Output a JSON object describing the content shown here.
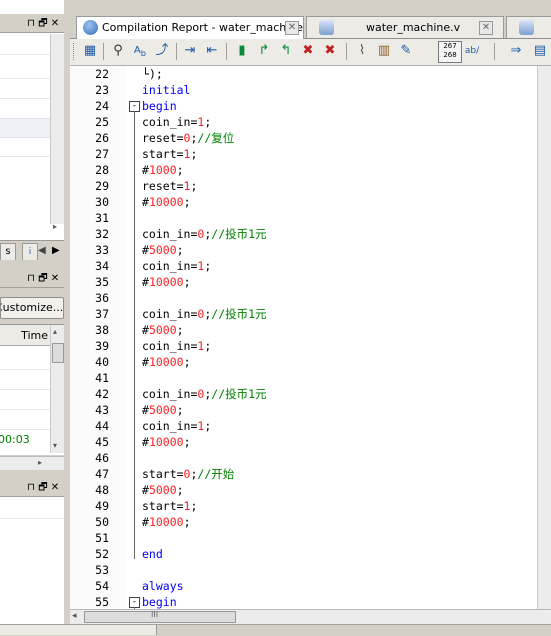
{
  "left_panel": {
    "panel1_buttons": [
      "⊓",
      "🗗",
      "✕"
    ],
    "panel2_buttons": [
      "⊓",
      "🗗",
      "✕"
    ],
    "panel3_buttons": [
      "⊓",
      "🗗",
      "✕"
    ],
    "customize_label": "Customize...",
    "time_header": "Time",
    "time_value": "00:03"
  },
  "tabs": [
    {
      "label": "Compilation Report - water_machine"
    },
    {
      "label": "water_machine.v"
    }
  ],
  "toolbar": {
    "badge_top": "267",
    "badge_bottom": "268",
    "ab_label": "ab/"
  },
  "editor": {
    "lines": [
      {
        "n": "22",
        "code": [
          [
            "",
            "└"
          ],
          [
            "",
            ");"
          ]
        ]
      },
      {
        "n": "23",
        "code": [
          [
            "kw",
            "initial"
          ]
        ]
      },
      {
        "n": "24",
        "code": [
          [
            "kw",
            "begin"
          ]
        ]
      },
      {
        "n": "25",
        "code": [
          [
            "",
            "coin_in="
          ],
          [
            "num",
            "1"
          ],
          [
            "",
            ";"
          ]
        ]
      },
      {
        "n": "26",
        "code": [
          [
            "",
            "reset="
          ],
          [
            "num",
            "0"
          ],
          [
            "",
            ";"
          ],
          [
            "cm",
            "//复位"
          ]
        ]
      },
      {
        "n": "27",
        "code": [
          [
            "",
            "start="
          ],
          [
            "num",
            "1"
          ],
          [
            "",
            ";"
          ]
        ]
      },
      {
        "n": "28",
        "code": [
          [
            "",
            "#"
          ],
          [
            "num",
            "1000"
          ],
          [
            "",
            ";"
          ]
        ]
      },
      {
        "n": "29",
        "code": [
          [
            "",
            "reset="
          ],
          [
            "num",
            "1"
          ],
          [
            "",
            ";"
          ]
        ]
      },
      {
        "n": "30",
        "code": [
          [
            "",
            "#"
          ],
          [
            "num",
            "10000"
          ],
          [
            "",
            ";"
          ]
        ]
      },
      {
        "n": "31",
        "code": []
      },
      {
        "n": "32",
        "code": [
          [
            "",
            "coin_in="
          ],
          [
            "num",
            "0"
          ],
          [
            "",
            ";"
          ],
          [
            "cm",
            "//投币1元"
          ]
        ]
      },
      {
        "n": "33",
        "code": [
          [
            "",
            "#"
          ],
          [
            "num",
            "5000"
          ],
          [
            "",
            ";"
          ]
        ]
      },
      {
        "n": "34",
        "code": [
          [
            "",
            "coin_in="
          ],
          [
            "num",
            "1"
          ],
          [
            "",
            ";"
          ]
        ]
      },
      {
        "n": "35",
        "code": [
          [
            "",
            "#"
          ],
          [
            "num",
            "10000"
          ],
          [
            "",
            ";"
          ]
        ]
      },
      {
        "n": "36",
        "code": []
      },
      {
        "n": "37",
        "code": [
          [
            "",
            "coin_in="
          ],
          [
            "num",
            "0"
          ],
          [
            "",
            ";"
          ],
          [
            "cm",
            "//投币1元"
          ]
        ]
      },
      {
        "n": "38",
        "code": [
          [
            "",
            "#"
          ],
          [
            "num",
            "5000"
          ],
          [
            "",
            ";"
          ]
        ]
      },
      {
        "n": "39",
        "code": [
          [
            "",
            "coin_in="
          ],
          [
            "num",
            "1"
          ],
          [
            "",
            ";"
          ]
        ]
      },
      {
        "n": "40",
        "code": [
          [
            "",
            "#"
          ],
          [
            "num",
            "10000"
          ],
          [
            "",
            ";"
          ]
        ]
      },
      {
        "n": "41",
        "code": []
      },
      {
        "n": "42",
        "code": [
          [
            "",
            "coin_in="
          ],
          [
            "num",
            "0"
          ],
          [
            "",
            ";"
          ],
          [
            "cm",
            "//投币1元"
          ]
        ]
      },
      {
        "n": "43",
        "code": [
          [
            "",
            "#"
          ],
          [
            "num",
            "5000"
          ],
          [
            "",
            ";"
          ]
        ]
      },
      {
        "n": "44",
        "code": [
          [
            "",
            "coin_in="
          ],
          [
            "num",
            "1"
          ],
          [
            "",
            ";"
          ]
        ]
      },
      {
        "n": "45",
        "code": [
          [
            "",
            "#"
          ],
          [
            "num",
            "10000"
          ],
          [
            "",
            ";"
          ]
        ]
      },
      {
        "n": "46",
        "code": []
      },
      {
        "n": "47",
        "code": [
          [
            "",
            "start="
          ],
          [
            "num",
            "0"
          ],
          [
            "",
            ";"
          ],
          [
            "cm",
            "//开始"
          ]
        ]
      },
      {
        "n": "48",
        "code": [
          [
            "",
            "#"
          ],
          [
            "num",
            "5000"
          ],
          [
            "",
            ";"
          ]
        ]
      },
      {
        "n": "49",
        "code": [
          [
            "",
            "start="
          ],
          [
            "num",
            "1"
          ],
          [
            "",
            ";"
          ]
        ]
      },
      {
        "n": "50",
        "code": [
          [
            "",
            "#"
          ],
          [
            "num",
            "10000"
          ],
          [
            "",
            ";"
          ]
        ]
      },
      {
        "n": "51",
        "code": []
      },
      {
        "n": "52",
        "code": [
          [
            "kw",
            "end"
          ]
        ]
      },
      {
        "n": "53",
        "code": []
      },
      {
        "n": "54",
        "code": [
          [
            "kw",
            "always"
          ]
        ]
      },
      {
        "n": "55",
        "code": [
          [
            "kw",
            "begin"
          ]
        ]
      }
    ],
    "hscroll_grip": "III"
  },
  "colors": {
    "keyword": "#0000ff",
    "number": "#ff2020",
    "comment": "#008000"
  }
}
